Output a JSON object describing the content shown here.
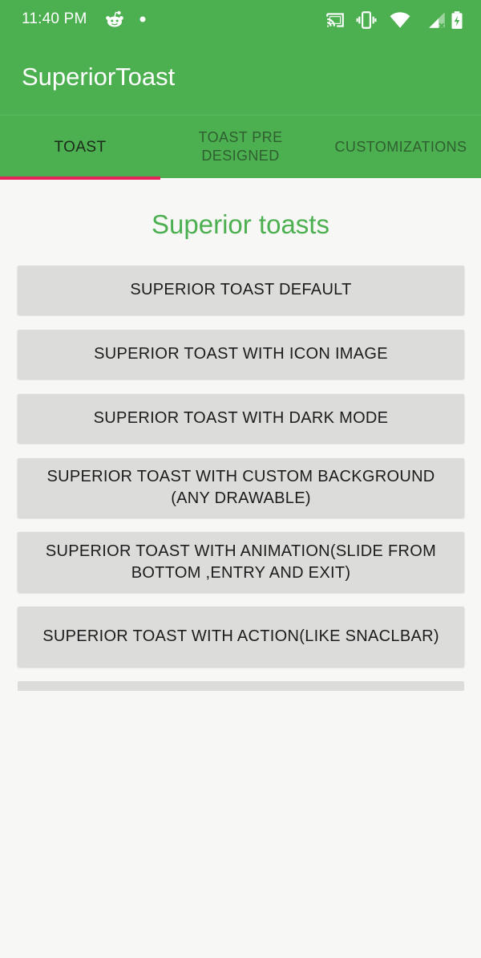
{
  "status_bar": {
    "time": "11:40 PM",
    "left_icons": [
      "reddit-icon",
      "dot-icon"
    ],
    "right_icons": [
      "cast-icon",
      "vibrate-icon",
      "wifi-icon",
      "signal-icon",
      "battery-charging-icon"
    ]
  },
  "app_bar": {
    "title": "SuperiorToast"
  },
  "tabs": [
    {
      "label": "TOAST",
      "active": true
    },
    {
      "label": "TOAST PRE DESIGNED",
      "active": false
    },
    {
      "label": "CUSTOMIZATIONS",
      "active": false
    }
  ],
  "colors": {
    "primary": "#4caf50",
    "tab_indicator": "#e4245a",
    "button_bg": "#dcdcdb",
    "background": "#f7f7f5"
  },
  "main": {
    "heading": "Superior toasts",
    "buttons": [
      "SUPERIOR TOAST DEFAULT",
      "SUPERIOR TOAST WITH ICON IMAGE",
      "SUPERIOR TOAST WITH DARK MODE",
      "SUPERIOR TOAST WITH CUSTOM BACKGROUND (ANY DRAWABLE)",
      "SUPERIOR TOAST WITH ANIMATION(SLIDE FROM BOTTOM ,ENTRY AND EXIT)",
      "SUPERIOR TOAST WITH ACTION(LIKE SNACLBAR)"
    ]
  }
}
